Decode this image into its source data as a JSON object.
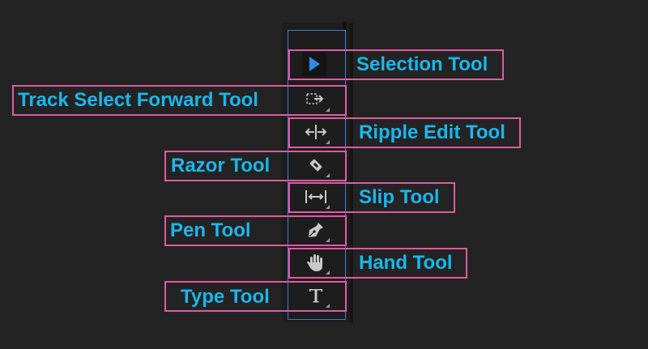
{
  "colors": {
    "label": "#1bb6ec",
    "callout_border": "#e05ba1",
    "guide": "#3a7bd5",
    "selection_arrow": "#2d8ceb",
    "icon": "#c8c8c8"
  },
  "tools": [
    {
      "label": "Selection Tool",
      "icon": "selection-arrow-icon",
      "active": true
    },
    {
      "label": "Track Select Forward Tool",
      "icon": "track-select-forward-icon"
    },
    {
      "label": "Ripple Edit Tool",
      "icon": "ripple-edit-icon"
    },
    {
      "label": "Razor Tool",
      "icon": "razor-blade-icon"
    },
    {
      "label": "Slip Tool",
      "icon": "slip-icon"
    },
    {
      "label": "Pen Tool",
      "icon": "pen-nib-icon"
    },
    {
      "label": "Hand Tool",
      "icon": "hand-icon"
    },
    {
      "label": "Type Tool",
      "icon": "type-t-icon"
    }
  ]
}
